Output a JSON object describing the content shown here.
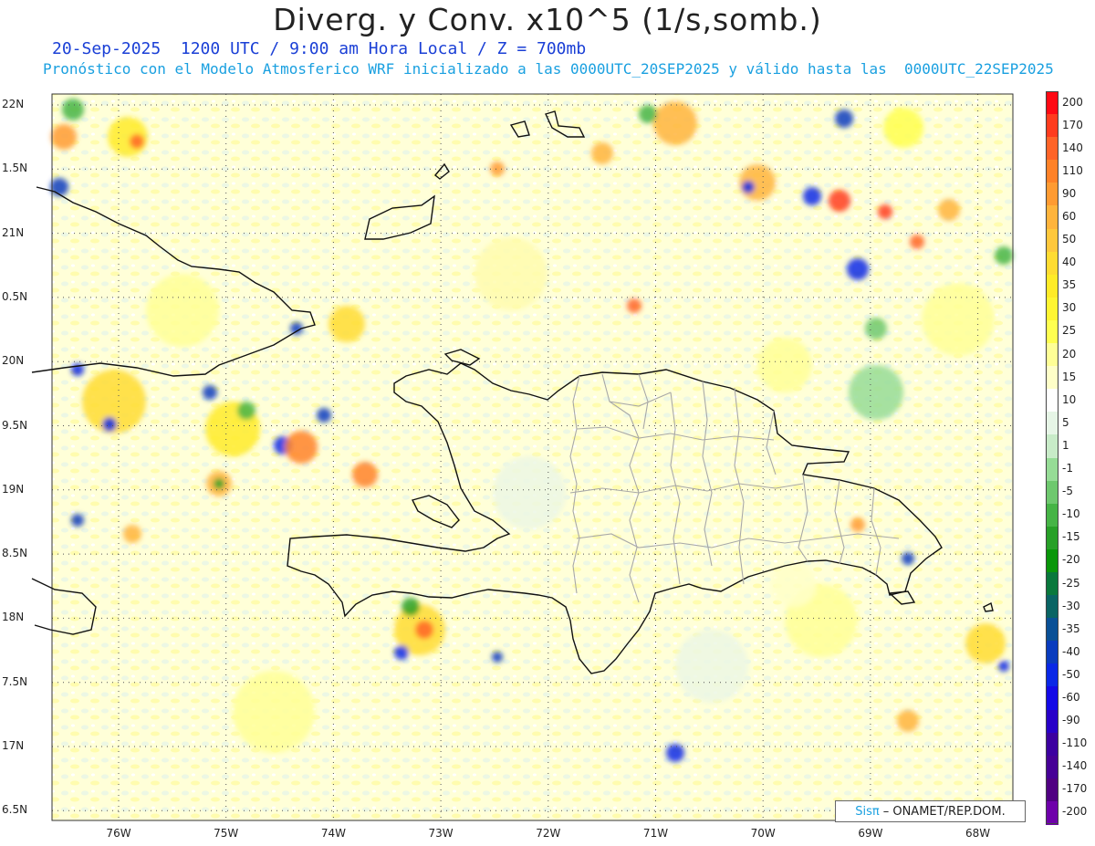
{
  "header": {
    "title": "Diverg. y Conv. x10^5 (1/s,somb.)",
    "subtitle1": "20-Sep-2025  1200 UTC / 9:00 am Hora Local / Z = 700mb",
    "subtitle2": "Pronóstico con el Modelo Atmosferico WRF inicializado a las 0000UTC_20SEP2025 y válido hasta las  0000UTC_22SEP2025"
  },
  "map": {
    "y_axis_labels": [
      "22N",
      "1.5N",
      "21N",
      "0.5N",
      "20N",
      "9.5N",
      "19N",
      "8.5N",
      "18N",
      "7.5N",
      "17N",
      "6.5N"
    ],
    "x_axis_labels": [
      "76W",
      "75W",
      "74W",
      "73W",
      "72W",
      "71W",
      "70W",
      "69W",
      "68W"
    ]
  },
  "colorbar": {
    "labels": [
      "200",
      "170",
      "140",
      "110",
      "90",
      "60",
      "50",
      "40",
      "35",
      "30",
      "25",
      "20",
      "15",
      "10",
      "5",
      "1",
      "-1",
      "-5",
      "-10",
      "-15",
      "-20",
      "-25",
      "-30",
      "-35",
      "-40",
      "-50",
      "-60",
      "-90",
      "-110",
      "-140",
      "-170",
      "-200"
    ],
    "colors": [
      "#ff0a14",
      "#ff3c1e",
      "#ff6428",
      "#ff8228",
      "#ff9b32",
      "#ffb43c",
      "#ffc83c",
      "#ffdc32",
      "#ffeb28",
      "#fff532",
      "#ffff50",
      "#ffff96",
      "#ffffc8",
      "#ffffff",
      "#e6f5e6",
      "#c8ebc8",
      "#96dc96",
      "#6ec86e",
      "#46b446",
      "#28a028",
      "#0a960a",
      "#0a783c",
      "#0a6464",
      "#0a5096",
      "#0a3cbe",
      "#0a28e6",
      "#140ae6",
      "#2800c8",
      "#3c00a0",
      "#460096",
      "#500082",
      "#6e00aa"
    ]
  },
  "branding": {
    "sis": "Sisπ",
    "text": "– ONAMET/REP.DOM."
  }
}
